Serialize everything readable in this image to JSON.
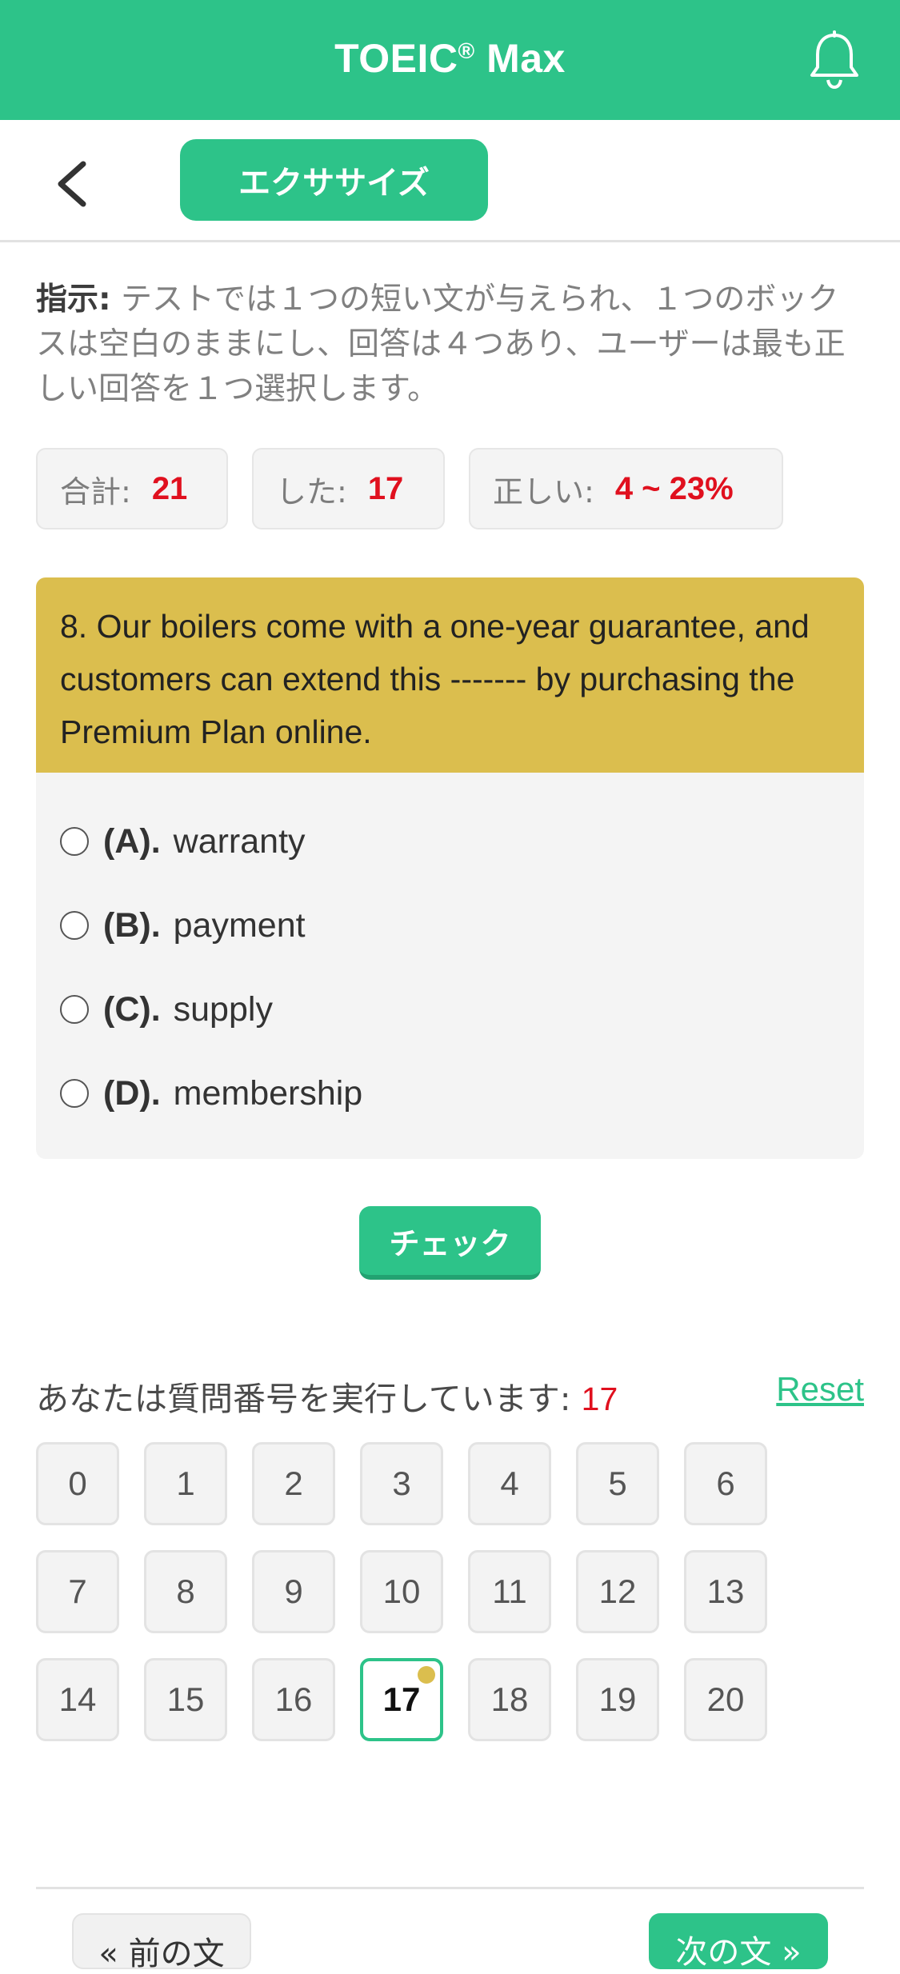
{
  "header": {
    "title": "TOEIC",
    "title_mark": "®",
    "title_suffix": "Max",
    "bell_icon": "bell-icon"
  },
  "nav": {
    "tab_label": "エクササイズ",
    "back_icon": "chevron-left-icon"
  },
  "instructions": {
    "label": "指示:",
    "text": "テストでは１つの短い文が与えられ、１つのボックスは空白のままにし、回答は４つあり、ユーザーは最も正しい回答を１つ選択します。"
  },
  "stats": {
    "total_label": "合計:",
    "total_value": "21",
    "done_label": "した:",
    "done_value": "17",
    "correct_label": "正しい:",
    "correct_value": "4 ~ 23%"
  },
  "question": {
    "text": "8. Our boilers come with a one-year guarantee, and customers can extend this ------- by purchasing the Premium Plan online.",
    "options": [
      {
        "key": "(A).",
        "text": "warranty"
      },
      {
        "key": "(B).",
        "text": "payment"
      },
      {
        "key": "(C).",
        "text": "supply"
      },
      {
        "key": "(D).",
        "text": "membership"
      }
    ]
  },
  "check_label": "チェック",
  "progress": {
    "label": "あなたは質問番号を実行しています:",
    "current": "17",
    "reset_label": "Reset"
  },
  "question_numbers": [
    "0",
    "1",
    "2",
    "3",
    "4",
    "5",
    "6",
    "7",
    "8",
    "9",
    "10",
    "11",
    "12",
    "13",
    "14",
    "15",
    "16",
    "17",
    "18",
    "19",
    "20"
  ],
  "footer": {
    "prev_label": "« 前の文",
    "next_label": "次の文 »"
  },
  "colors": {
    "accent": "#2dc389",
    "question_bg": "#dbbe4e",
    "highlight": "#e0101e"
  }
}
